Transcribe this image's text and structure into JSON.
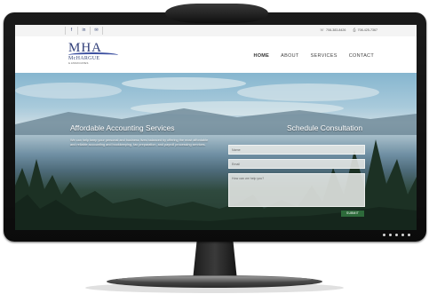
{
  "site": {
    "social": [
      "f",
      "in",
      "✉"
    ],
    "contact": {
      "phone": "708-383-8426",
      "fax": "708-425-7367"
    },
    "logo": {
      "mark": "MHA",
      "name": "McHARGUE",
      "sub": "& ASSOCIATES"
    },
    "nav": [
      {
        "label": "HOME",
        "active": true
      },
      {
        "label": "ABOUT",
        "active": false
      },
      {
        "label": "SERVICES",
        "active": false
      },
      {
        "label": "CONTACT",
        "active": false
      }
    ],
    "hero": {
      "title": "Affordable Accounting Services",
      "text": "We can help keep your personal and business lives balanced by offering the most affordable and reliable accounting and bookkeeping, tax preparation, and payroll processing services."
    },
    "form": {
      "title": "Schedule Consultation",
      "name_placeholder": "Name",
      "email_placeholder": "Email",
      "message_placeholder": "How can we help you?",
      "submit_label": "SUBMIT"
    }
  },
  "colors": {
    "brand": "#2f3d78",
    "submit": "#2d6a3a",
    "bezel": "#111111"
  }
}
